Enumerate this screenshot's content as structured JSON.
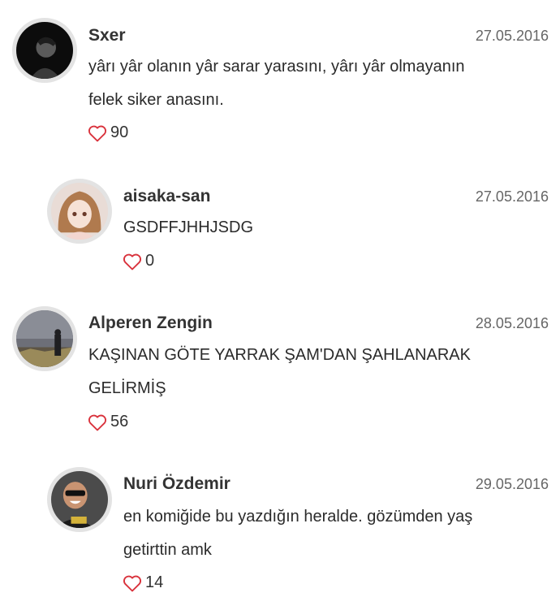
{
  "comments": [
    {
      "username": "Sxer",
      "date": "27.05.2016",
      "lines": [
        "yârı yâr olanın yâr sarar yarasını, yârı yâr olmayanın",
        "felek siker anasını."
      ],
      "likes": "90",
      "indented": false
    },
    {
      "username": "aisaka-san",
      "date": "27.05.2016",
      "lines": [
        "GSDFFJHHJSDG"
      ],
      "likes": "0",
      "indented": true
    },
    {
      "username": "Alperen Zengin",
      "date": "28.05.2016",
      "lines": [
        "KAŞINAN GÖTE YARRAK ŞAM'DAN ŞAHLANARAK",
        "GELİRMİŞ"
      ],
      "likes": "56",
      "indented": false
    },
    {
      "username": "Nuri Özdemir",
      "date": "29.05.2016",
      "lines": [
        "en komiğide bu yazdığın heralde. gözümden yaş",
        "getirttin amk"
      ],
      "likes": "14",
      "indented": true
    }
  ],
  "icons": {
    "like": "heart-outline-icon"
  },
  "colors": {
    "heart": "#d9323c",
    "avatar_ring": "#e3e3e3"
  }
}
